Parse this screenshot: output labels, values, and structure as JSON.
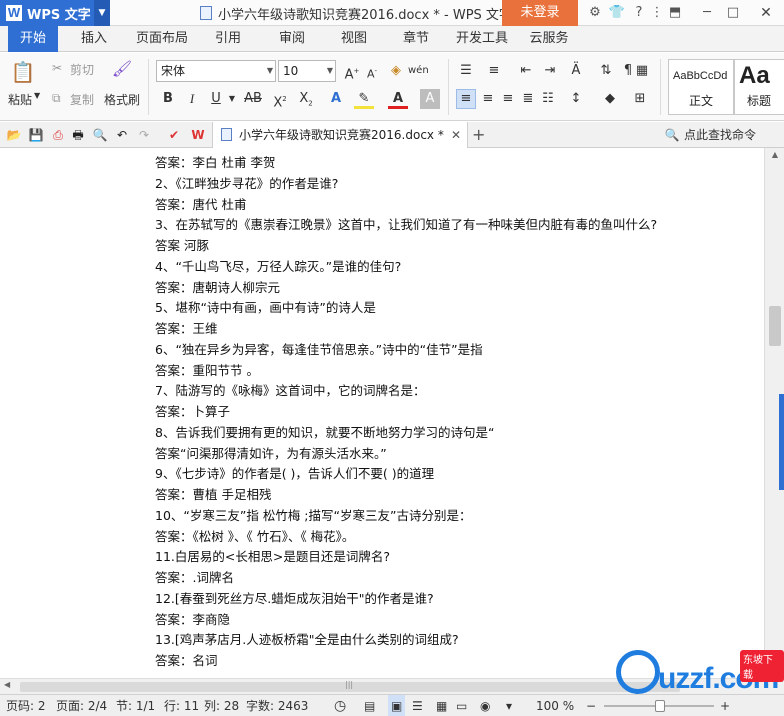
{
  "app": {
    "name": "WPS 文字",
    "logo_letter": "W",
    "doc_title": "小学六年级诗歌知识竞赛2016.docx * - WPS 文字",
    "login": "未登录",
    "accent": "#2f6fd3",
    "login_color": "#e8713c"
  },
  "tabs": [
    "开始",
    "插入",
    "页面布局",
    "引用",
    "审阅",
    "视图",
    "章节",
    "开发工具",
    "云服务"
  ],
  "ribbon": {
    "paste": "粘贴",
    "cut": "剪切",
    "copy": "复制",
    "format_painter": "格式刷",
    "font_name": "宋体",
    "font_size": "10",
    "style_normal_preview": "AaBbCcDd",
    "style_normal": "正文",
    "style_heading_preview": "Aa",
    "style_heading": "标题"
  },
  "toolbar": {
    "doc_tab": "小学六年级诗歌知识竞赛2016.docx *",
    "find_command": "点此查找命令"
  },
  "document": {
    "lines": [
      "答案：李白 杜甫 李贺",
      "2、《江畔独步寻花》的作者是谁?",
      "答案：唐代 杜甫",
      "3、在苏轼写的《惠崇春江晚景》这首中，让我们知道了有一种味美但内脏有毒的鱼叫什么?",
      "答案 河豚",
      "4、“千山鸟飞尽，万径人踪灭。”是谁的佳句?",
      "答案：唐朝诗人柳宗元",
      "5、堪称“诗中有画，画中有诗”的诗人是",
      "答案：王维",
      "6、“独在异乡为异客，每逢佳节倍思亲。”诗中的“佳节”是指",
      "答案：重阳节节 。",
      "7、陆游写的《咏梅》这首词中，它的词牌名是：",
      "答案：卜算子",
      "8、告诉我们要拥有更的知识，就要不断地努力学习的诗句是“",
      "答案“问渠那得清如许，为有源头活水来。”",
      "9、《七步诗》的作者是( )，告诉人们不要( )的道理",
      "答案：曹植 手足相残",
      "10、“岁寒三友”指 松竹梅 ;描写“岁寒三友”古诗分别是：",
      "答案：《松树 》、《 竹石》、《 梅花》。",
      "11.白居易的<长相思>是题目还是词牌名?",
      "答案：.词牌名",
      "12.[春蚕到死丝方尽.蜡炬成灰泪始干\"的作者是谁?",
      "答案：李商隐",
      "13.[鸡声茅店月.人迹板桥霜\"全是由什么类别的词组成?",
      "答案：名词"
    ]
  },
  "status": {
    "page_no": "页码: 2",
    "pages": "页面: 2/4",
    "section": "节: 1/1",
    "row": "行: 11",
    "col": "列: 28",
    "words": "字数: 2463",
    "zoom": "100 %",
    "zoom_level": 1.0
  },
  "watermark": {
    "text": "uzzf.com",
    "tag": "东坡下载",
    "color": "#1f7de0"
  }
}
